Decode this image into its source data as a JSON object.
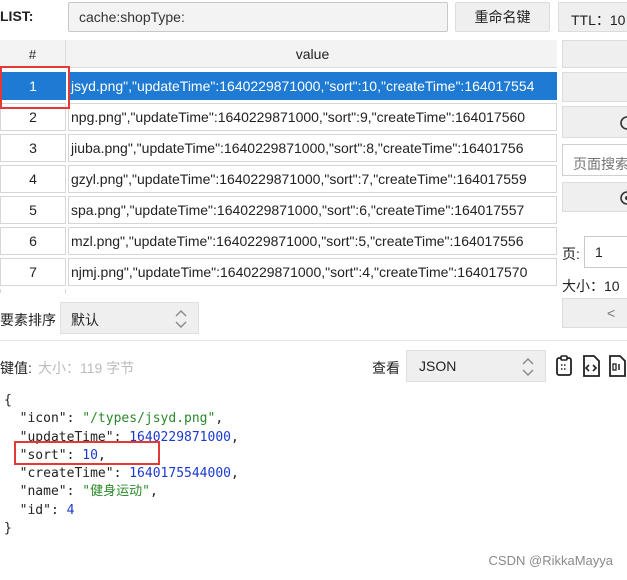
{
  "header": {
    "type_label": "LIST:",
    "key_value": "cache:shopType:",
    "rename_label": "重命名键",
    "ttl_label": "TTL：10"
  },
  "table": {
    "col_index": "#",
    "col_value": "value",
    "rows": [
      {
        "index": "1",
        "value": "jsyd.png\",\"updateTime\":1640229871000,\"sort\":10,\"createTime\":164017554",
        "selected": true
      },
      {
        "index": "2",
        "value": "npg.png\",\"updateTime\":1640229871000,\"sort\":9,\"createTime\":164017560",
        "selected": false
      },
      {
        "index": "3",
        "value": "jiuba.png\",\"updateTime\":1640229871000,\"sort\":8,\"createTime\":16401756",
        "selected": false
      },
      {
        "index": "4",
        "value": "gzyl.png\",\"updateTime\":1640229871000,\"sort\":7,\"createTime\":164017559",
        "selected": false
      },
      {
        "index": "5",
        "value": "spa.png\",\"updateTime\":1640229871000,\"sort\":6,\"createTime\":164017557",
        "selected": false
      },
      {
        "index": "6",
        "value": "mzl.png\",\"updateTime\":1640229871000,\"sort\":5,\"createTime\":164017556",
        "selected": false
      },
      {
        "index": "7",
        "value": "njmj.png\",\"updateTime\":1640229871000,\"sort\":4,\"createTime\":164017570",
        "selected": false
      }
    ]
  },
  "right_panel": {
    "search_placeholder": "页面搜索",
    "page_label": "页:",
    "page_value": "1",
    "size_label": "大小：10",
    "prev_glyph": "<"
  },
  "sort": {
    "label": "要素排序",
    "value": "默认"
  },
  "keyvalue": {
    "label": "键值:",
    "size_text": "大小：119 字节",
    "view_label": "查看",
    "view_value": "JSON"
  },
  "json_view": {
    "open": "{",
    "icon_key": "\"icon\"",
    "icon_val": "\"/types/jsyd.png\"",
    "update_key": "\"updateTime\"",
    "update_val": "1640229871000",
    "sort_key": "\"sort\"",
    "sort_val": "10",
    "create_key": "\"createTime\"",
    "create_val": "1640175544000",
    "name_key": "\"name\"",
    "name_val": "\"健身运动\"",
    "id_key": "\"id\"",
    "id_val": "4",
    "close": "}"
  },
  "icons": [
    "clipboard-icon",
    "code-file-icon",
    "binary-file-icon",
    "up-down-arrows-icon"
  ],
  "colors": {
    "selected_row": "#1e7ad3",
    "highlight_box": "#e53935",
    "json_string": "#2a8a2a",
    "json_number": "#1a3ad0"
  },
  "watermark": "CSDN @RikkaMayya"
}
